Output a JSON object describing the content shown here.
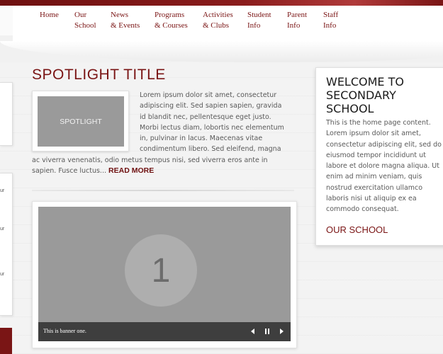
{
  "nav": {
    "items": [
      {
        "line1": "Home",
        "line2": ""
      },
      {
        "line1": "Our",
        "line2": "School"
      },
      {
        "line1": "News",
        "line2": "& Events"
      },
      {
        "line1": "Programs",
        "line2": "& Courses"
      },
      {
        "line1": "Activities",
        "line2": "& Clubs"
      },
      {
        "line1": "Student",
        "line2": "Info"
      },
      {
        "line1": "Parent",
        "line2": "Info"
      },
      {
        "line1": "Staff",
        "line2": "Info"
      }
    ]
  },
  "left_fragments": [
    "ur",
    "ur",
    "ur"
  ],
  "spotlight": {
    "title": "SPOTLIGHT TITLE",
    "thumb_label": "SPOTLIGHT",
    "body": "Lorem ipsum dolor sit amet, consectetur adipiscing elit. Sed sapien sapien, gravida id blandit nec, pellentesque eget justo. Morbi lectus diam, lobortis nec elementum in, pulvinar in lacus. Maecenas vitae condimentum libero. Sed eleifend, magna ac viverra venenatis, odio metus tempus nisi, sed viverra eros ante in sapien. Fusce luctus...",
    "read_more": "READ MORE"
  },
  "banner": {
    "slide_number": "1",
    "caption": "This is banner one.",
    "controls": [
      "prev-icon",
      "pause-icon",
      "next-icon"
    ]
  },
  "welcome": {
    "title": "WELCOME TO SECONDARY SCHOOL",
    "body": "This is the home page content. Lorem ipsum dolor sit amet, consectetur adipiscing elit, sed do eiusmod tempor incididunt ut labore et dolore magna aliqua. Ut enim ad minim veniam, quis nostrud exercitation ullamco laboris nisi ut aliquip ex ea commodo consequat.",
    "link": "OUR SCHOOL"
  },
  "colors": {
    "accent": "#7a1414",
    "top_strip": "#8a1c1c",
    "banner_bg": "#9a9a9a",
    "banner_bar": "#3e3e3e"
  }
}
